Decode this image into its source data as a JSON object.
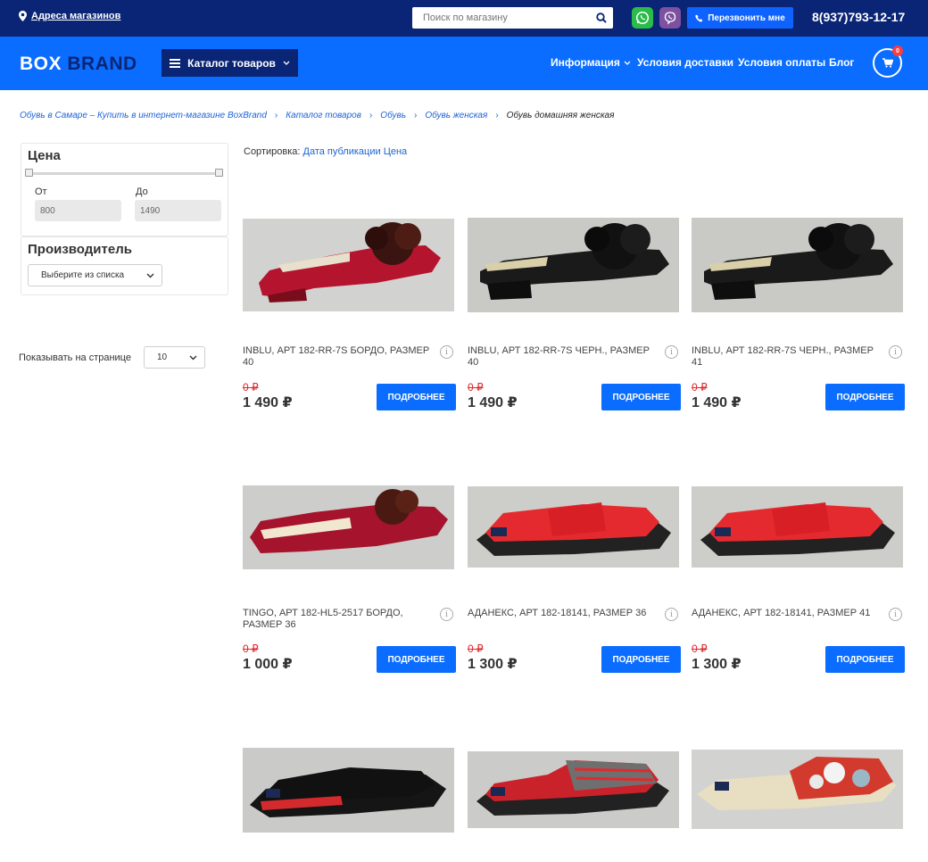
{
  "topbar": {
    "stores_label": "Адреса магазинов",
    "search_placeholder": "Поиск по магазину",
    "callback_label": "Перезвонить мне",
    "phone": "8(937)793-12-17"
  },
  "header": {
    "logo_part1": "BOX",
    "logo_part2": "BRAND",
    "catalog_label": "Каталог товаров",
    "nav": [
      "Информация",
      "Условия доставки",
      "Условия оплаты",
      "Блог"
    ],
    "cart_count": "0"
  },
  "breadcrumb": [
    "Обувь в Самаре – Купить в интернет-магазине BoxBrand",
    "Каталог товаров",
    "Обувь",
    "Обувь женская",
    "Обувь домашняя женская"
  ],
  "filters": {
    "price_title": "Цена",
    "from_label": "От",
    "to_label": "До",
    "from_value": "800",
    "to_value": "1490",
    "manufacturer_title": "Производитель",
    "manufacturer_select": "Выберите из списка"
  },
  "per_page": {
    "label": "Показывать на странице",
    "value": "10"
  },
  "sort": {
    "label": "Сортировка:",
    "options": [
      "Дата публикации",
      "Цена"
    ]
  },
  "products": [
    {
      "title": "INBLU, АРТ 182-RR-7S БОРДО, РАЗМЕР 40",
      "old_price": "0 ₽",
      "price": "1 490 ₽",
      "button": "ПОДРОБНЕЕ"
    },
    {
      "title": "INBLU, АРТ 182-RR-7S ЧЕРН., РАЗМЕР 40",
      "old_price": "0 ₽",
      "price": "1 490 ₽",
      "button": "ПОДРОБНЕЕ"
    },
    {
      "title": "INBLU, АРТ 182-RR-7S ЧЕРН., РАЗМЕР 41",
      "old_price": "0 ₽",
      "price": "1 490 ₽",
      "button": "ПОДРОБНЕЕ"
    },
    {
      "title": "TINGO, АРТ 182-HL5-2517 БОРДО, РАЗМЕР 36",
      "old_price": "0 ₽",
      "price": "1 000 ₽",
      "button": "ПОДРОБНЕЕ"
    },
    {
      "title": "АДАНЕКС, АРТ 182-18141, РАЗМЕР 36",
      "old_price": "0 ₽",
      "price": "1 300 ₽",
      "button": "ПОДРОБНЕЕ"
    },
    {
      "title": "АДАНЕКС, АРТ 182-18141, РАЗМЕР 41",
      "old_price": "0 ₽",
      "price": "1 300 ₽",
      "button": "ПОДРОБНЕЕ"
    },
    {
      "title": "",
      "old_price": "",
      "price": "",
      "button": ""
    },
    {
      "title": "",
      "old_price": "",
      "price": "",
      "button": ""
    },
    {
      "title": "",
      "old_price": "",
      "price": "",
      "button": ""
    }
  ],
  "info_glyph": "i",
  "colors": {
    "topbar": "#0a2575",
    "header": "#0a6dff",
    "accent": "#0a6dff",
    "old_price": "#e0262b",
    "link": "#1c63d6"
  }
}
